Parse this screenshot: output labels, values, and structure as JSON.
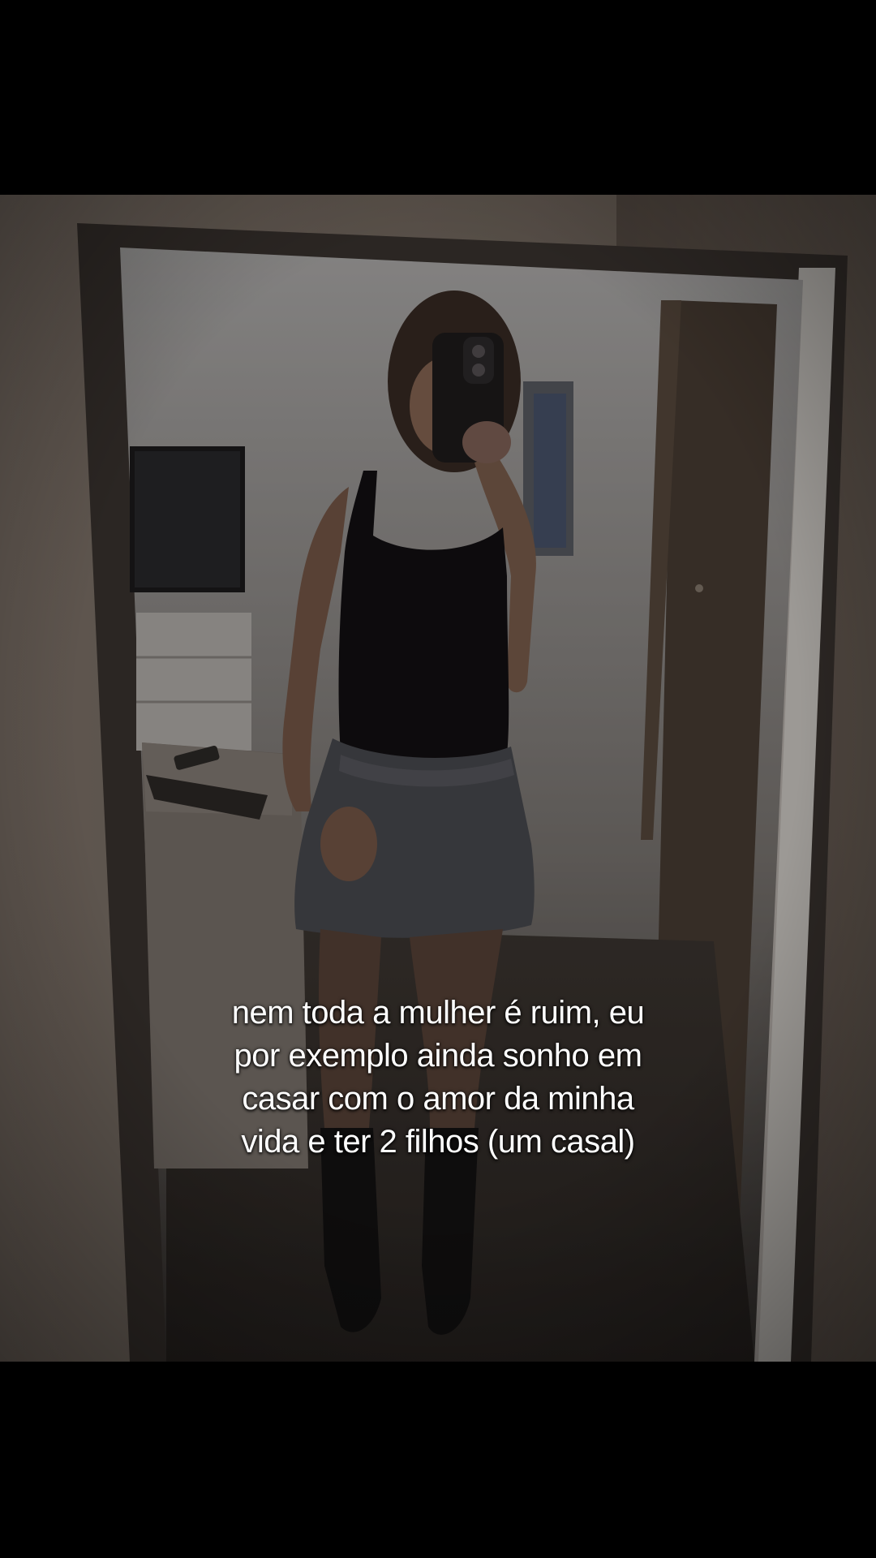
{
  "video": {
    "background_color": "#000000",
    "caption_lines": [
      "nem toda a mulher é ruim, eu",
      "por exemplo ainda sonho em",
      "casar com o amor da minha",
      "vida e ter 2 filhos (um casal)"
    ],
    "caption_color": "#ffffff"
  }
}
